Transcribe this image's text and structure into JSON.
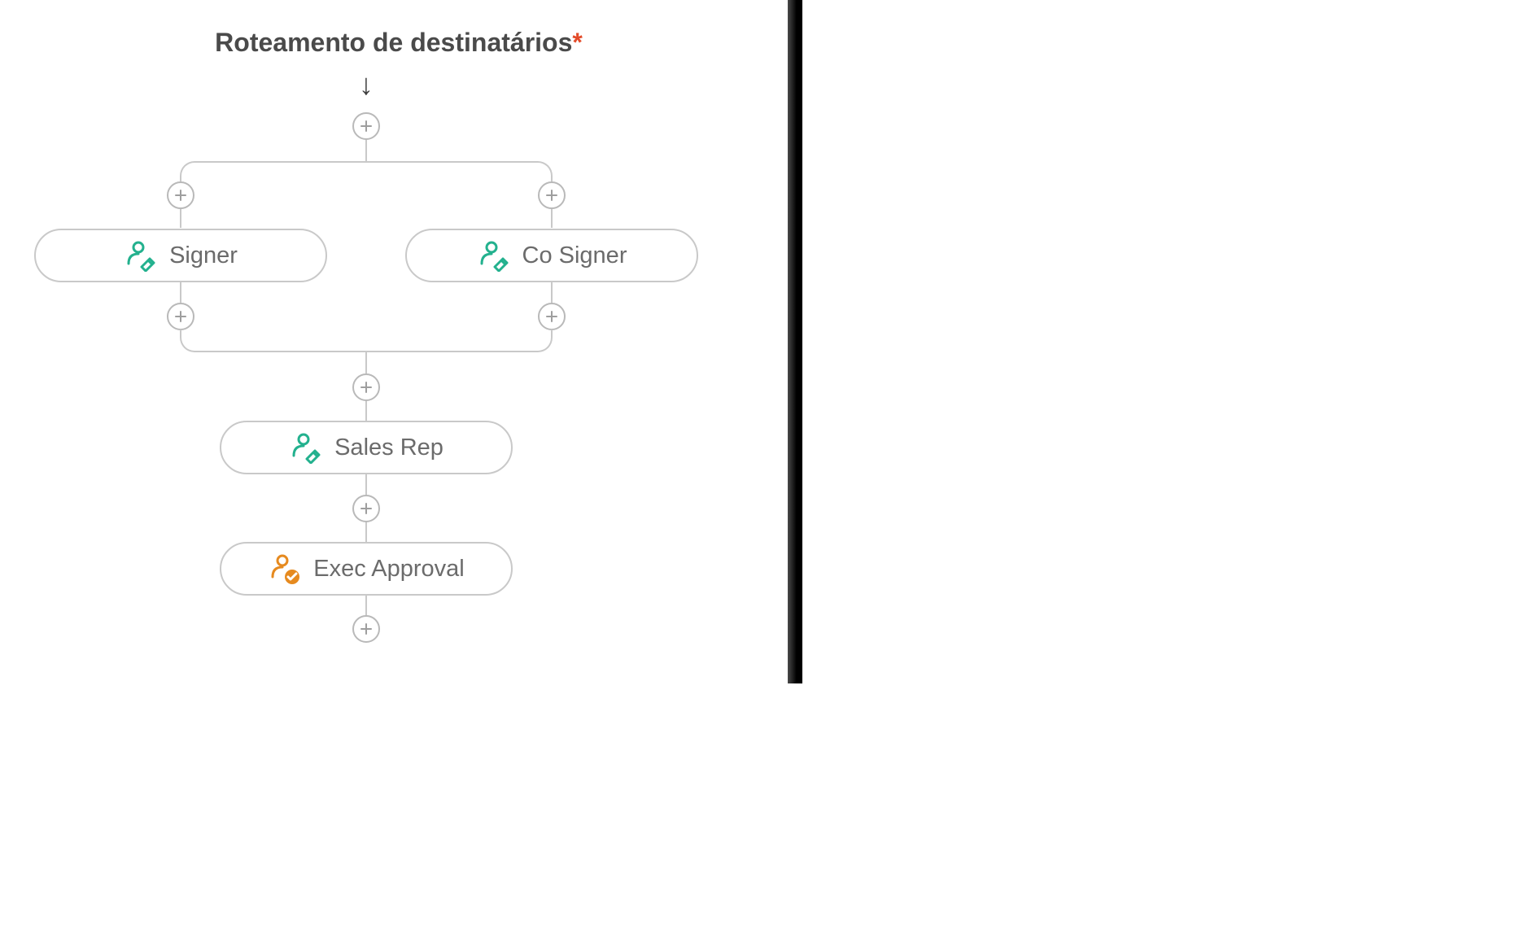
{
  "title": {
    "text": "Roteamento de destinatários",
    "required_mark": "*"
  },
  "colors": {
    "signer_icon": "#23b18e",
    "approver_icon": "#e68a1f",
    "line": "#c9c9c9",
    "text": "#6b6b6b",
    "required": "#e34b2a"
  },
  "flow": {
    "parallel": [
      {
        "id": "signer",
        "label": "Signer",
        "role": "signer"
      },
      {
        "id": "cosigner",
        "label": "Co Signer",
        "role": "signer"
      }
    ],
    "sequential": [
      {
        "id": "salesrep",
        "label": "Sales Rep",
        "role": "signer"
      },
      {
        "id": "exec",
        "label": "Exec Approval",
        "role": "approver"
      }
    ]
  }
}
